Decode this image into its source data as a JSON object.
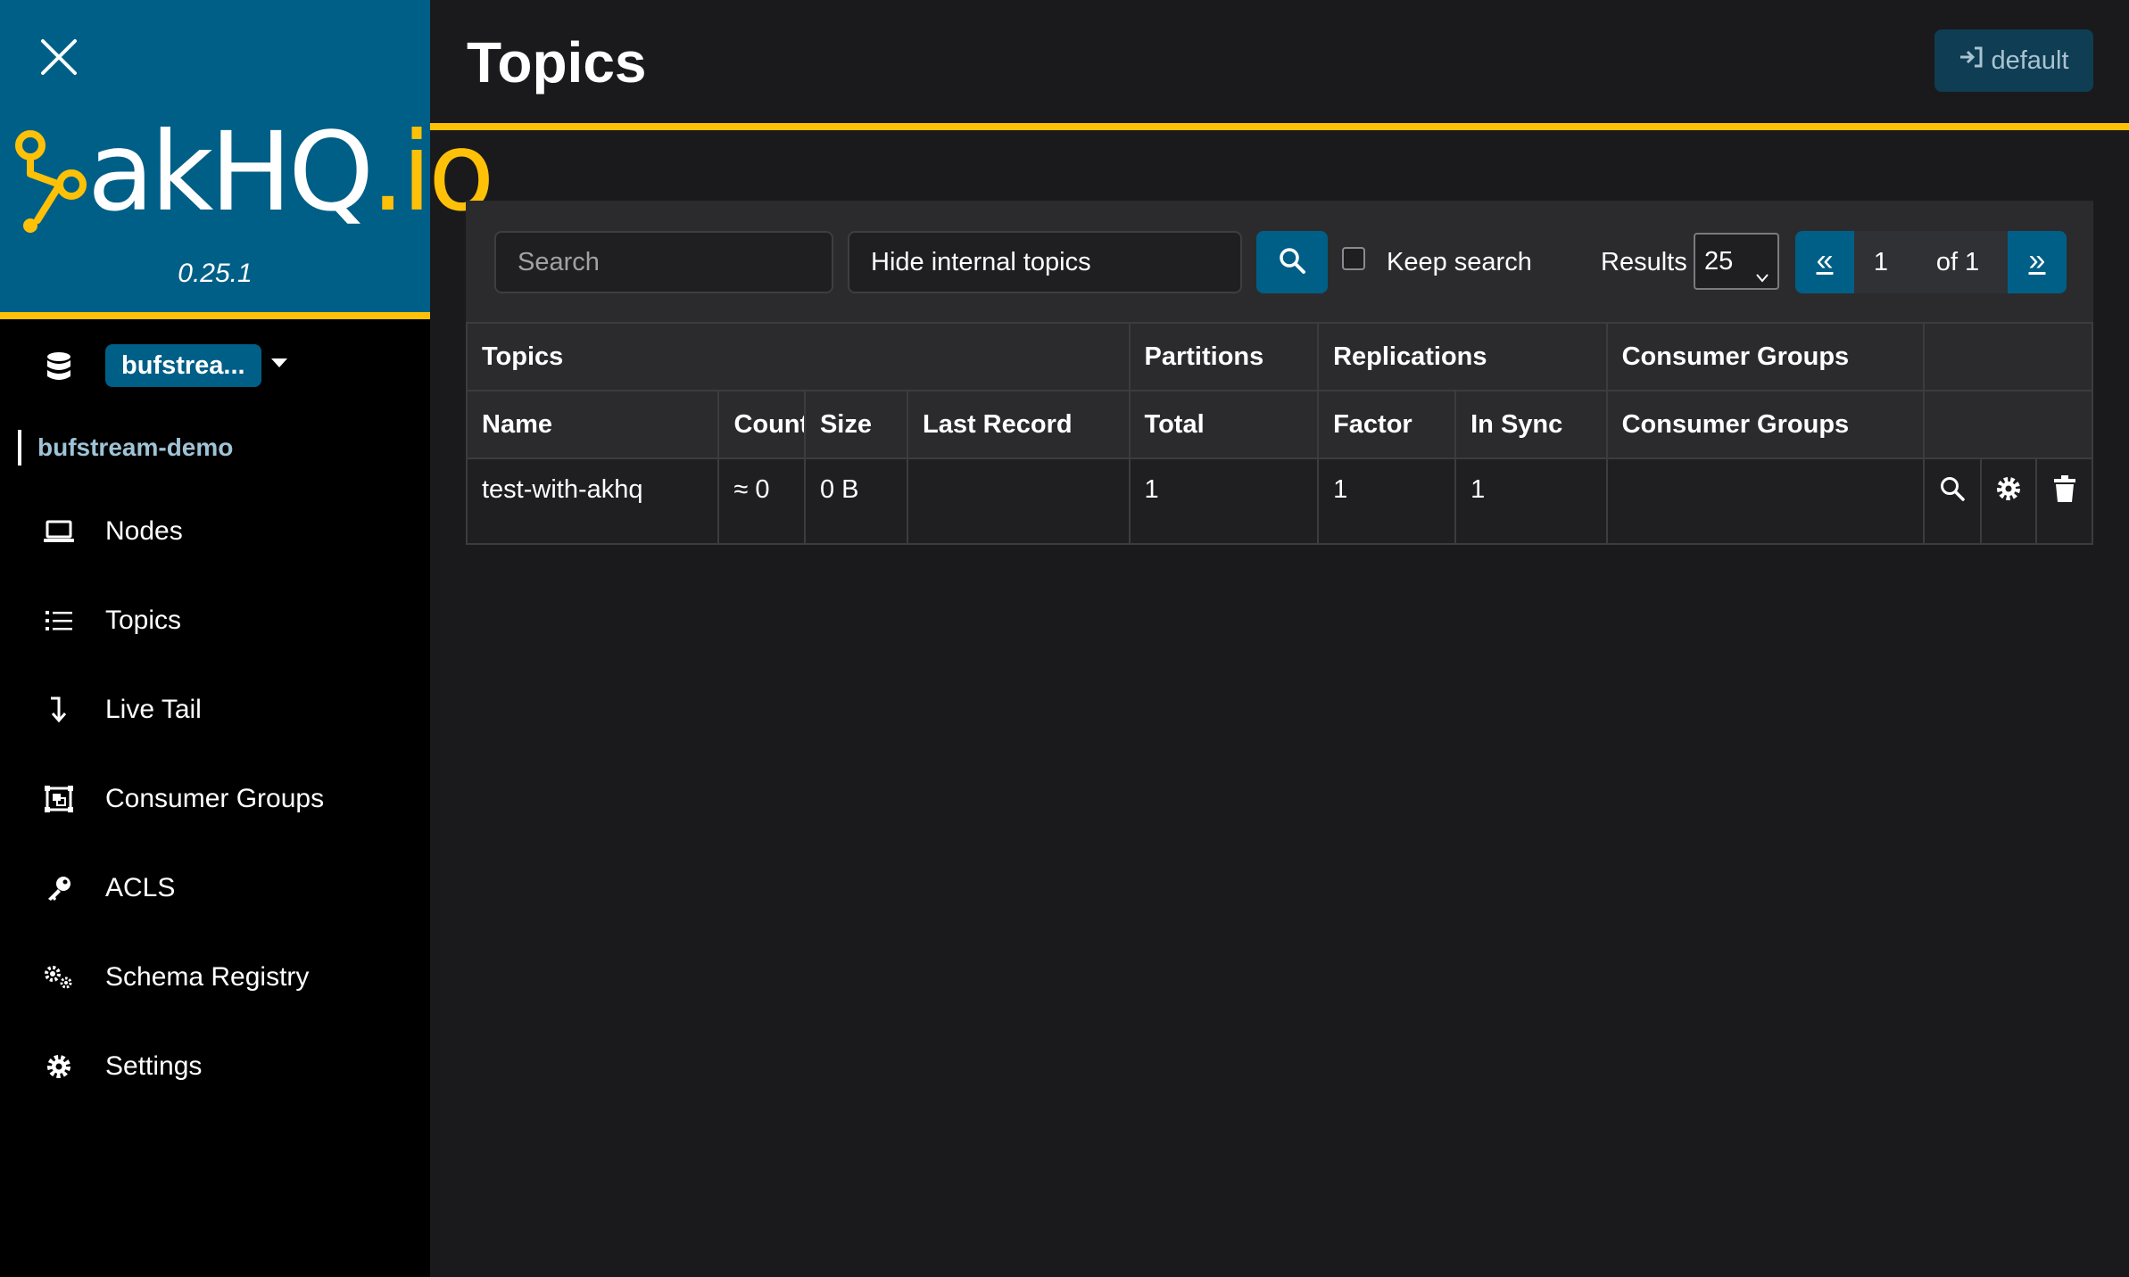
{
  "app": {
    "logo_text_main": "akHQ",
    "logo_text_accent": ".io",
    "version": "0.25.1",
    "colors": {
      "brand": "#005f87",
      "accent": "#ffc107",
      "sidebar": "#000000",
      "background": "#1a1a1c"
    }
  },
  "sidebar": {
    "close_icon": "close-icon",
    "cluster_selector": {
      "icon": "database-icon",
      "label": "bufstrea...",
      "caret": "caret-down-icon"
    },
    "cluster_name": "bufstream-demo",
    "items": [
      {
        "label": "Nodes",
        "icon": "laptop-icon"
      },
      {
        "label": "Topics",
        "icon": "list-icon"
      },
      {
        "label": "Live Tail",
        "icon": "level-down-icon"
      },
      {
        "label": "Consumer Groups",
        "icon": "object-group-icon"
      },
      {
        "label": "ACLS",
        "icon": "key-icon"
      },
      {
        "label": "Schema Registry",
        "icon": "cogs-icon"
      },
      {
        "label": "Settings",
        "icon": "cog-icon"
      }
    ]
  },
  "header": {
    "title": "Topics",
    "login_button": {
      "icon": "sign-in-icon",
      "label": "default"
    }
  },
  "toolbar": {
    "search_placeholder": "Search",
    "filter_value": "Hide internal topics",
    "search_button_icon": "search-icon",
    "keep_search_label": "Keep search",
    "keep_search_checked": false,
    "results_label": "Results",
    "results_value": "25",
    "pagination": {
      "prev": "«",
      "current": "1",
      "total": "of 1",
      "next": "»"
    }
  },
  "table": {
    "group_headers": [
      "Topics",
      "Partitions",
      "Replications",
      "Consumer Groups",
      ""
    ],
    "column_headers": [
      "Name",
      "Count",
      "Size",
      "Last Record",
      "Total",
      "Factor",
      "In Sync",
      "Consumer Groups",
      ""
    ],
    "rows": [
      {
        "name": "test-with-akhq",
        "count": "≈ 0",
        "size": "0 B",
        "last_record": "",
        "partitions_total": "1",
        "replication_factor": "1",
        "in_sync": "1",
        "consumer_groups": "",
        "actions": [
          "search-icon",
          "cog-icon",
          "trash-icon"
        ]
      }
    ]
  }
}
